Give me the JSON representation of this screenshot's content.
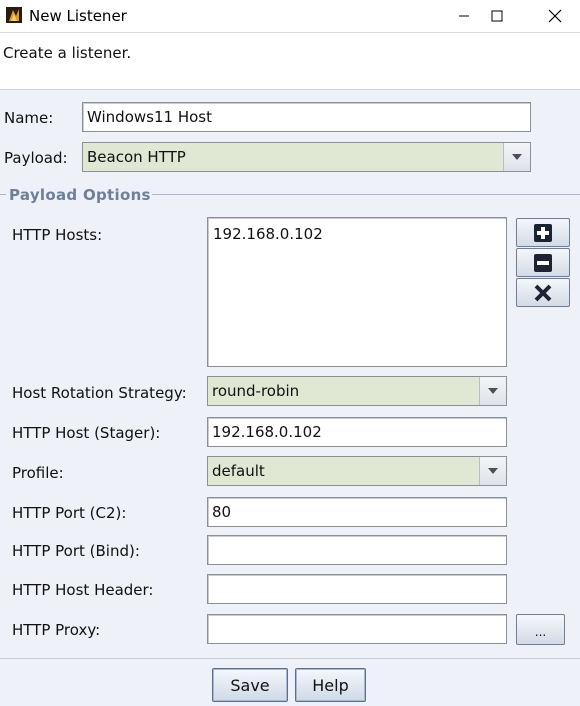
{
  "window": {
    "title": "New Listener",
    "minimize_icon": "minimize-icon",
    "maximize_icon": "maximize-icon",
    "close_icon": "close-icon"
  },
  "header": {
    "description": "Create a listener."
  },
  "form": {
    "name_label": "Name:",
    "name_value": "Windows11 Host",
    "payload_label": "Payload:",
    "payload_value": "Beacon HTTP"
  },
  "payload_options": {
    "title": "Payload Options",
    "http_hosts_label": "HTTP Hosts:",
    "http_hosts": [
      "192.168.0.102"
    ],
    "add_icon": "plus-icon",
    "remove_icon": "minus-icon",
    "clear_icon": "x-icon",
    "rotation_label": "Host Rotation Strategy:",
    "rotation_value": "round-robin",
    "stager_label": "HTTP Host (Stager):",
    "stager_value": "192.168.0.102",
    "profile_label": "Profile:",
    "profile_value": "default",
    "port_c2_label": "HTTP Port (C2):",
    "port_c2_value": "80",
    "port_bind_label": "HTTP Port (Bind):",
    "port_bind_value": "",
    "host_header_label": "HTTP Host Header:",
    "host_header_value": "",
    "proxy_label": "HTTP Proxy:",
    "proxy_value": "",
    "proxy_button": "..."
  },
  "buttons": {
    "save": "Save",
    "help": "Help"
  }
}
